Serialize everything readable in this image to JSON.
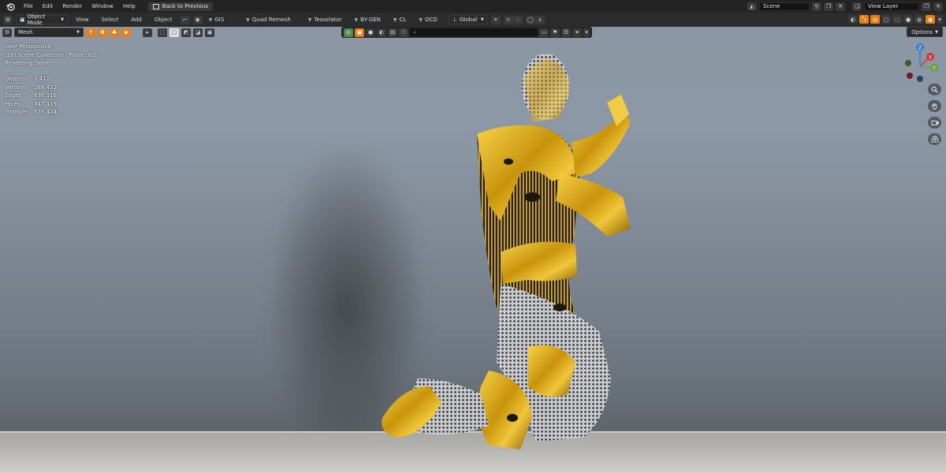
{
  "topbar": {
    "menus": [
      "File",
      "Edit",
      "Render",
      "Window",
      "Help"
    ],
    "back_button": "Back to Previous",
    "scene_label": "Scene",
    "view_layer_label": "View Layer"
  },
  "header": {
    "mode": "Object Mode",
    "menus": [
      "View",
      "Select",
      "Add",
      "Object"
    ],
    "addons": [
      "GIS",
      "Quad Remesh",
      "Tesselator",
      "BY-GEN",
      "CL",
      "OCD"
    ],
    "transform": "Global"
  },
  "toolrow": {
    "mesh_select": "Mesh"
  },
  "search": {
    "placeholder": ""
  },
  "options_label": "Options",
  "overlay": {
    "line1": "User Perspective",
    "line2": "(29) Scene Collection | Plane.002",
    "line3": "Rendering Done"
  },
  "stats": [
    {
      "label": "Objects",
      "value": "3,412"
    },
    {
      "label": "Vertices",
      "value": "288,432"
    },
    {
      "label": "Edges",
      "value": "636,316"
    },
    {
      "label": "Faces",
      "value": "347,419"
    },
    {
      "label": "Triangles",
      "value": "576,424"
    }
  ],
  "gizmo": {
    "x": "X",
    "y": "Y",
    "z": "Z"
  },
  "colors": {
    "accent": "#e47f1a",
    "gold": "#d9a90f",
    "axis_x": "#d6313f",
    "axis_y": "#6ea13a",
    "axis_z": "#3f7bd6"
  }
}
